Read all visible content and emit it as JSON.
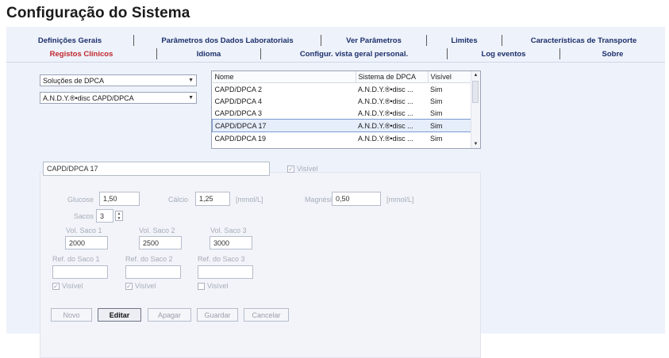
{
  "page_title": "Configuração do Sistema",
  "tabs_row1": [
    "Definições Gerais",
    "Parâmetros dos Dados Laboratoriais",
    "Ver Parâmetros",
    "Limites",
    "Características de Transporte"
  ],
  "tabs_row2": [
    "Registos Clínicos",
    "Idioma",
    "Configur. vista geral personal.",
    "Log eventos",
    "Sobre"
  ],
  "active_tab": "Registos Clínicos",
  "combo1": "Soluções de DPCA",
  "combo2": "A.N.D.Y.®•disc CAPD/DPCA",
  "grid": {
    "headers": [
      "Nome",
      "Sistema de DPCA",
      "Visível"
    ],
    "rows": [
      {
        "nome": "CAPD/DPCA 2",
        "sistema": "A.N.D.Y.®•disc ...",
        "visivel": "Sim"
      },
      {
        "nome": "CAPD/DPCA 4",
        "sistema": "A.N.D.Y.®•disc ...",
        "visivel": "Sim"
      },
      {
        "nome": "CAPD/DPCA 3",
        "sistema": "A.N.D.Y.®•disc ...",
        "visivel": "Sim"
      },
      {
        "nome": "CAPD/DPCA 17",
        "sistema": "A.N.D.Y.®•disc ...",
        "visivel": "Sim"
      },
      {
        "nome": "CAPD/DPCA 19",
        "sistema": "A.N.D.Y.®•disc ...",
        "visivel": "Sim"
      }
    ],
    "selected_row": 3
  },
  "detail": {
    "name_value": "CAPD/DPCA 17",
    "visible_label": "Visível",
    "glucose_label": "Glucose",
    "glucose_value": "1,50",
    "calcio_label": "Cálcio",
    "calcio_value": "1,25",
    "magnesio_label": "Magnésio",
    "magnesio_value": "0,50",
    "unit": "[mmol/L]",
    "sacos_label": "Sacos",
    "sacos_value": "3",
    "vol_saco_1_label": "Vol. Saco 1",
    "vol_saco_1_value": "2000",
    "vol_saco_2_label": "Vol. Saco 2",
    "vol_saco_2_value": "2500",
    "vol_saco_3_label": "Vol. Saco 3",
    "vol_saco_3_value": "3000",
    "ref_saco_1_label": "Ref. do Saco 1",
    "ref_saco_2_label": "Ref. do Saco 2",
    "ref_saco_3_label": "Ref. do Saco 3",
    "ref_saco_1_value": "",
    "ref_saco_2_value": "",
    "ref_saco_3_value": "",
    "visivel_label": "Visível"
  },
  "buttons": {
    "novo": "Novo",
    "editar": "Editar",
    "apagar": "Apagar",
    "guardar": "Guardar",
    "cancelar": "Cancelar"
  },
  "colors": {
    "active_tab": "#c0272d",
    "tab_text": "#1b2f6b",
    "frame_bg": "#eef2fa",
    "selected_row_border": "#7b9bd3"
  }
}
